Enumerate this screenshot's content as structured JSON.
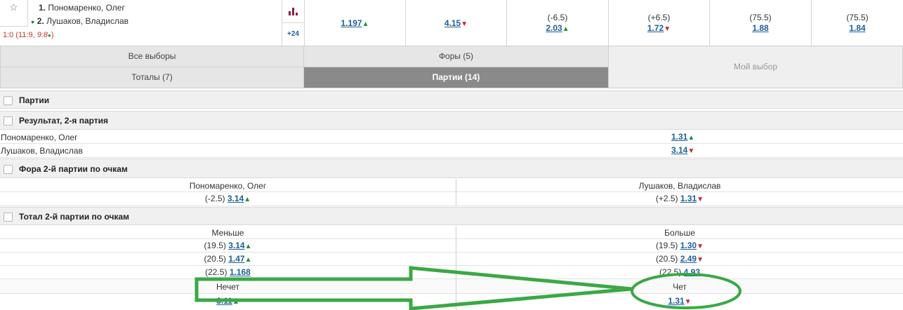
{
  "match": {
    "player1_num": "1.",
    "player1": "Пономаренко, Олег",
    "player2_num": "2.",
    "player2": "Лушаков, Владислав",
    "score": "1:0 (11:9, ",
    "score_live": "9:8",
    "score_end": ")",
    "more_markets": "+24",
    "odds": [
      {
        "param": "",
        "value": "1.197",
        "dir": "up"
      },
      {
        "param": "",
        "value": "4.15",
        "dir": "down"
      },
      {
        "param": "(-6.5)",
        "value": "2.03",
        "dir": "up"
      },
      {
        "param": "(+6.5)",
        "value": "1.72",
        "dir": "down"
      },
      {
        "param": "(75.5)",
        "value": "1.88",
        "dir": ""
      },
      {
        "param": "(75.5)",
        "value": "1.84",
        "dir": ""
      }
    ]
  },
  "tabs": {
    "all": "Все выборы",
    "handicaps": "Форы (5)",
    "totals": "Тоталы (7)",
    "sets": "Партии (14)",
    "my_choice": "Мой выбор"
  },
  "sections": {
    "sets": "Партии",
    "result2": "Результат, 2-я партия",
    "handicap2": "Фора 2-й партии по очкам",
    "total2": "Тотал 2-й партии по очкам"
  },
  "result2_rows": [
    {
      "name": "Пономаренко, Олег",
      "value": "1.31",
      "dir": "up"
    },
    {
      "name": "Лушаков, Владислав",
      "value": "3.14",
      "dir": "down"
    }
  ],
  "handicap2": {
    "col1": "Пономаренко, Олег",
    "col2": "Лушаков, Владислав",
    "left_param": "(-2.5)",
    "left_value": "3.14",
    "left_dir": "up",
    "right_param": "(+2.5)",
    "right_value": "1.31",
    "right_dir": "down"
  },
  "total2": {
    "col1": "Меньше",
    "col2": "Больше",
    "rows": [
      {
        "lp": "(19.5)",
        "lv": "3.14",
        "ld": "up",
        "rp": "(19.5)",
        "rv": "1.30",
        "rd": "down"
      },
      {
        "lp": "(20.5)",
        "lv": "1.47",
        "ld": "up",
        "rp": "(20.5)",
        "rv": "2.49",
        "rd": "down"
      },
      {
        "lp": "(22.5)",
        "lv": "1.168",
        "ld": "",
        "rp": "(22.5)",
        "rv": "4.93",
        "rd": ""
      }
    ]
  },
  "oddeven": {
    "odd_label": "Нечет",
    "even_label": "Чет",
    "odd_value": "3.11",
    "even_value": "1.31",
    "even_dir": "down"
  },
  "colors": {
    "link": "#1d5f98",
    "up": "#1f8f3a",
    "down": "#d0202a",
    "annotation": "#3aa845",
    "tab_active": "#8a8a8a"
  },
  "icons": {
    "favorite": "star-icon",
    "stats": "bar-chart-icon",
    "up": "arrow-up-icon",
    "down": "arrow-down-icon",
    "live": "live-dot-icon"
  }
}
